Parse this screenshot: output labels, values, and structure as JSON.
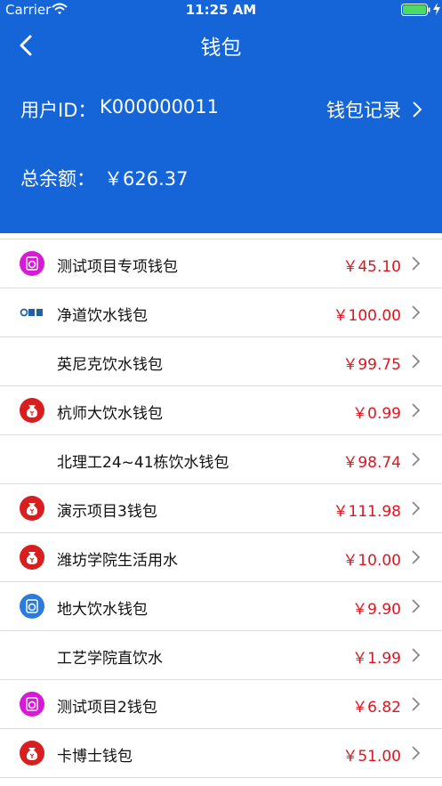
{
  "status_bar": {
    "carrier": "Carrier",
    "time": "11:25 AM"
  },
  "nav": {
    "title": "钱包"
  },
  "header": {
    "user_id_label": "用户ID：",
    "user_id_value": "K000000011",
    "records_label": "钱包记录",
    "total_label": "总余额：",
    "total_value": "￥626.37"
  },
  "colors": {
    "header_bg": "#1565d8",
    "amount_red": "#e0141e"
  },
  "wallets": [
    {
      "name": "测试项目专项钱包",
      "amount": "￥45.10",
      "icon": "magenta-washer-icon"
    },
    {
      "name": "净道饮水钱包",
      "amount": "￥100.00",
      "icon": "jingdao-logo-icon"
    },
    {
      "name": "英尼克饮水钱包",
      "amount": "￥99.75",
      "icon": ""
    },
    {
      "name": "杭师大饮水钱包",
      "amount": "￥0.99",
      "icon": "red-money-bag-icon"
    },
    {
      "name": "北理工24~41栋饮水钱包",
      "amount": "￥98.74",
      "icon": ""
    },
    {
      "name": "演示项目3钱包",
      "amount": "￥111.98",
      "icon": "red-money-bag-icon"
    },
    {
      "name": "潍坊学院生活用水",
      "amount": "￥10.00",
      "icon": "red-money-bag-icon"
    },
    {
      "name": "地大饮水钱包",
      "amount": "￥9.90",
      "icon": "blue-washer-icon"
    },
    {
      "name": "工艺学院直饮水",
      "amount": "￥1.99",
      "icon": ""
    },
    {
      "name": "测试项目2钱包",
      "amount": "￥6.82",
      "icon": "magenta-washer-icon"
    },
    {
      "name": "卡博士钱包",
      "amount": "￥51.00",
      "icon": "red-money-bag-icon"
    }
  ]
}
